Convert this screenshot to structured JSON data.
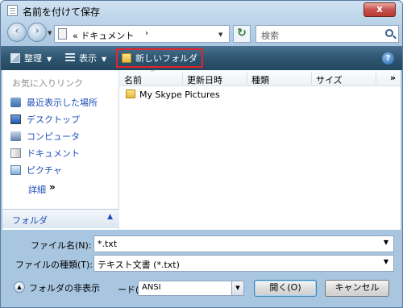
{
  "window": {
    "title": "名前を付けて保存",
    "close_label": "x"
  },
  "address": {
    "path": "« ドキュメント",
    "chevron": "›"
  },
  "search": {
    "placeholder": "検索"
  },
  "toolbar": {
    "organize": "整理",
    "views": "表示",
    "new_folder": "新しいフォルダ",
    "help": "?"
  },
  "sidebar": {
    "favorites_header": "お気に入りリンク",
    "items": [
      {
        "label": "最近表示した場所",
        "icon": "recent-places-icon"
      },
      {
        "label": "デスクトップ",
        "icon": "desktop-icon"
      },
      {
        "label": "コンピュータ",
        "icon": "computer-icon"
      },
      {
        "label": "ドキュメント",
        "icon": "documents-icon"
      },
      {
        "label": "ピクチャ",
        "icon": "pictures-icon"
      }
    ],
    "details": "詳細",
    "details_chevron": "»",
    "folders_bar": "フォルダ",
    "folders_caret": "^"
  },
  "files": {
    "columns": [
      "名前",
      "更新日時",
      "種類",
      "サイズ"
    ],
    "more": "»",
    "items": [
      {
        "name": "My Skype Pictures",
        "icon": "folder-icon"
      }
    ]
  },
  "form": {
    "filename_label": "ファイル名(N):",
    "filename_value": "*.txt",
    "filetype_label": "ファイルの種類(T):",
    "filetype_value": "テキスト文書 (*.txt)",
    "hide_folders": "フォルダの非表示",
    "encoding_label": "ード(E):",
    "encoding_value": "ANSI",
    "open": "開く(O)",
    "cancel": "キャンセル"
  },
  "colors": {
    "toolbar": "#2e5671",
    "link": "#1f4fb8",
    "highlight_frame": "#e2242b"
  }
}
